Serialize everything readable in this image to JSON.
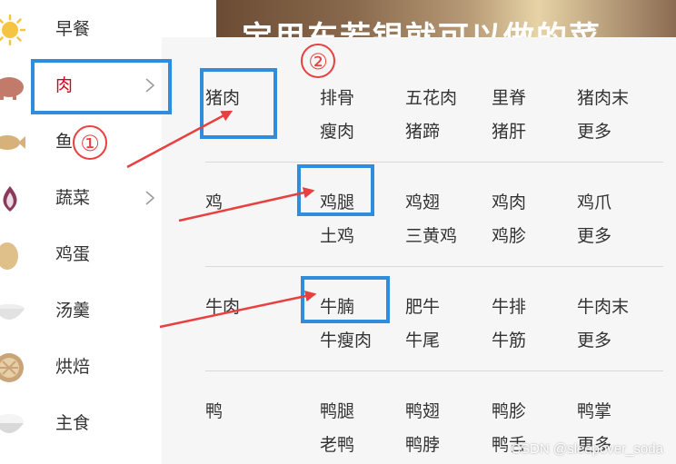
{
  "banner": {
    "title": "宝用车若银就可以做的菜"
  },
  "sidebar": {
    "items": [
      {
        "label": "早餐",
        "icon": "sun-icon",
        "has_submenu": false
      },
      {
        "label": "肉",
        "icon": "pig-icon",
        "has_submenu": true
      },
      {
        "label": "鱼",
        "icon": "fish-icon",
        "has_submenu": false
      },
      {
        "label": "蔬菜",
        "icon": "onion-icon",
        "has_submenu": true
      },
      {
        "label": "鸡蛋",
        "icon": "egg-icon",
        "has_submenu": false
      },
      {
        "label": "汤羹",
        "icon": "soup-bowl-icon",
        "has_submenu": false
      },
      {
        "label": "烘焙",
        "icon": "pie-icon",
        "has_submenu": false
      },
      {
        "label": "主食",
        "icon": "rice-bowl-icon",
        "has_submenu": false
      }
    ]
  },
  "submenu": {
    "sections": [
      {
        "label": "猪肉",
        "items": [
          "排骨",
          "五花肉",
          "里脊",
          "猪肉末",
          "瘦肉",
          "猪蹄",
          "猪肝",
          "更多"
        ]
      },
      {
        "label": "鸡",
        "items": [
          "鸡腿",
          "鸡翅",
          "鸡肉",
          "鸡爪",
          "土鸡",
          "三黄鸡",
          "鸡胗",
          "更多"
        ]
      },
      {
        "label": "牛肉",
        "items": [
          "牛腩",
          "肥牛",
          "牛排",
          "牛肉末",
          "牛瘦肉",
          "牛尾",
          "牛筋",
          "更多"
        ]
      },
      {
        "label": "鸭",
        "items": [
          "鸭腿",
          "鸭翅",
          "鸭胗",
          "鸭掌",
          "老鸭",
          "鸭脖",
          "鸭舌",
          "更多"
        ]
      }
    ]
  },
  "annotations": {
    "badge1": "①",
    "badge2": "②"
  },
  "watermark": "CSDN @sleepover_soda",
  "colors": {
    "accent_red": "#d0021b",
    "highlight_blue": "#2f8ddb",
    "arrow_red": "#e83f3f"
  }
}
